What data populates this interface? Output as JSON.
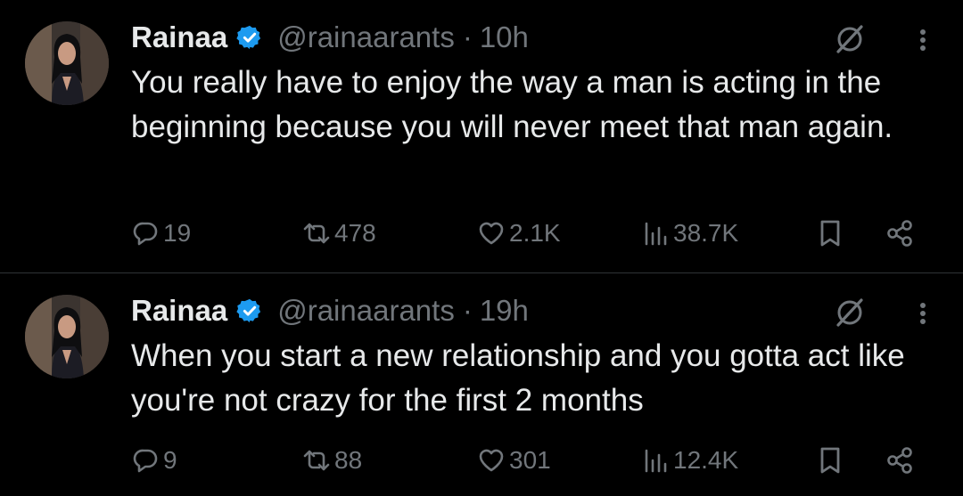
{
  "colors": {
    "background": "#000000",
    "text": "#e7e9ea",
    "muted": "#71767b",
    "verified": "#1d9bf0",
    "divider": "#2f3336"
  },
  "tweets": [
    {
      "name": "Rainaa",
      "handle": "@rainaarants",
      "separator": "·",
      "time": "10h",
      "text": "You really have to enjoy the way a man is acting in the beginning because you will never meet that man again.",
      "replies": "19",
      "reposts": "478",
      "likes": "2.1K",
      "views": "38.7K",
      "icons": [
        "verified-badge-icon",
        "grok-icon",
        "more-icon",
        "reply-icon",
        "repost-icon",
        "like-icon",
        "views-icon",
        "bookmark-icon",
        "share-icon"
      ]
    },
    {
      "name": "Rainaa",
      "handle": "@rainaarants",
      "separator": "·",
      "time": "19h",
      "text": "When you start a new relationship and you gotta act like you're not crazy for the first 2 months",
      "replies": "9",
      "reposts": "88",
      "likes": "301",
      "views": "12.4K",
      "icons": [
        "verified-badge-icon",
        "grok-icon",
        "more-icon",
        "reply-icon",
        "repost-icon",
        "like-icon",
        "views-icon",
        "bookmark-icon",
        "share-icon"
      ]
    }
  ]
}
